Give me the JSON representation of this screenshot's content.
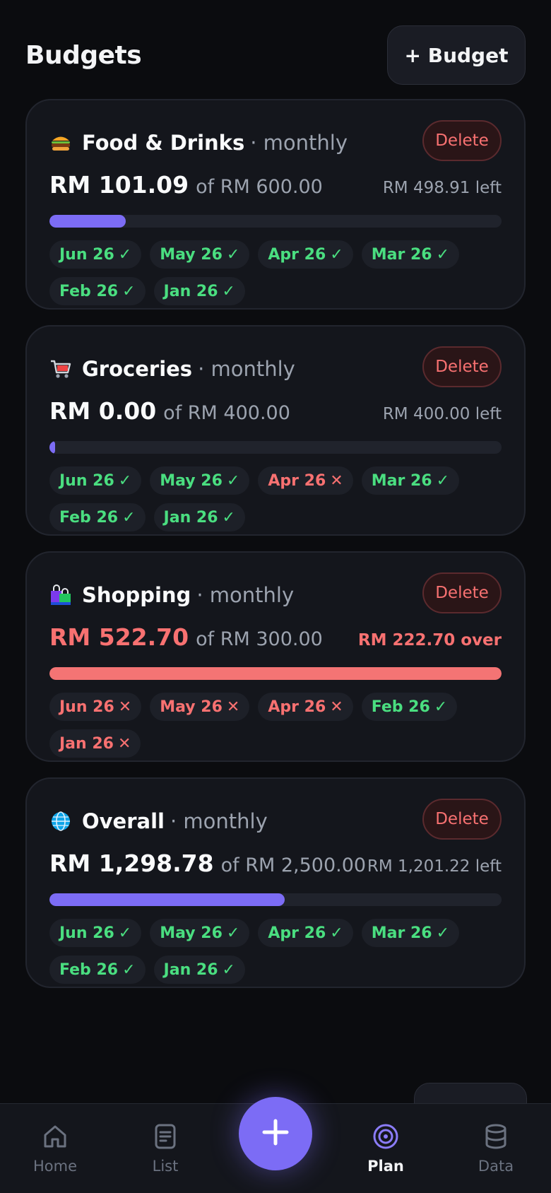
{
  "header": {
    "title": "Budgets",
    "add_label": "+ Budget"
  },
  "colors": {
    "accent": "#7c6cf5",
    "ok": "#4ade80",
    "bad": "#f87171",
    "background": "#0b0c0f"
  },
  "budgets": [
    {
      "icon": "burger-icon",
      "name": "Food & Drinks",
      "period": "· monthly",
      "spent": "RM 101.09",
      "limit": "of RM 600.00",
      "remaining": "RM 498.91 left",
      "progress": 0.168,
      "over": false,
      "delete_label": "Delete",
      "months": [
        {
          "label": "Jun 26",
          "mark": "✓",
          "status": "ok"
        },
        {
          "label": "May 26",
          "mark": "✓",
          "status": "ok"
        },
        {
          "label": "Apr 26",
          "mark": "✓",
          "status": "ok"
        },
        {
          "label": "Mar 26",
          "mark": "✓",
          "status": "ok"
        },
        {
          "label": "Feb 26",
          "mark": "✓",
          "status": "ok"
        },
        {
          "label": "Jan 26",
          "mark": "✓",
          "status": "ok"
        }
      ]
    },
    {
      "icon": "shopping-cart-icon",
      "name": "Groceries",
      "period": "· monthly",
      "spent": "RM 0.00",
      "limit": "of RM 400.00",
      "remaining": "RM 400.00 left",
      "progress": 0.0,
      "over": false,
      "delete_label": "Delete",
      "months": [
        {
          "label": "Jun 26",
          "mark": "✓",
          "status": "ok"
        },
        {
          "label": "May 26",
          "mark": "✓",
          "status": "ok"
        },
        {
          "label": "Apr 26",
          "mark": "✕",
          "status": "bad"
        },
        {
          "label": "Mar 26",
          "mark": "✓",
          "status": "ok"
        },
        {
          "label": "Feb 26",
          "mark": "✓",
          "status": "ok"
        },
        {
          "label": "Jan 26",
          "mark": "✓",
          "status": "ok"
        }
      ]
    },
    {
      "icon": "shopping-bags-icon",
      "name": "Shopping",
      "period": "· monthly",
      "spent": "RM 522.70",
      "limit": "of RM 300.00",
      "remaining": "RM 222.70 over",
      "progress": 1.0,
      "over": true,
      "delete_label": "Delete",
      "months": [
        {
          "label": "Jun 26",
          "mark": "✕",
          "status": "bad"
        },
        {
          "label": "May 26",
          "mark": "✕",
          "status": "bad"
        },
        {
          "label": "Apr 26",
          "mark": "✕",
          "status": "bad"
        },
        {
          "label": "Feb 26",
          "mark": "✓",
          "status": "ok"
        },
        {
          "label": "Jan 26",
          "mark": "✕",
          "status": "bad"
        }
      ]
    },
    {
      "icon": "globe-icon",
      "name": "Overall",
      "period": "· monthly",
      "spent": "RM 1,298.78",
      "limit": "of RM 2,500.00",
      "remaining": "RM 1,201.22 left",
      "progress": 0.52,
      "over": false,
      "delete_label": "Delete",
      "months": [
        {
          "label": "Jun 26",
          "mark": "✓",
          "status": "ok"
        },
        {
          "label": "May 26",
          "mark": "✓",
          "status": "ok"
        },
        {
          "label": "Apr 26",
          "mark": "✓",
          "status": "ok"
        },
        {
          "label": "Mar 26",
          "mark": "✓",
          "status": "ok"
        },
        {
          "label": "Feb 26",
          "mark": "✓",
          "status": "ok"
        },
        {
          "label": "Jan 26",
          "mark": "✓",
          "status": "ok"
        }
      ]
    }
  ],
  "nav": {
    "home": "Home",
    "list": "List",
    "plan": "Plan",
    "data": "Data",
    "active": "plan"
  }
}
